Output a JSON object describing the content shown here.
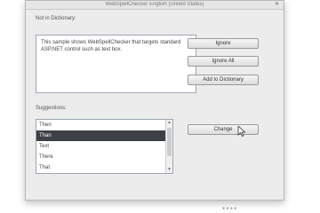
{
  "window": {
    "title": "WebSpellChecker English (United States)",
    "close_glyph": "✕"
  },
  "not_in_dictionary": {
    "label": "Not in Dictionary:",
    "text": "This sample shows WebSpellChecker that targets standard ASP.NET control such as text box."
  },
  "buttons": {
    "ignore": "Ignore",
    "ignore_all": "Ignore All",
    "add_to_dictionary": "Add to Dictionary",
    "change": "Change"
  },
  "suggestions": {
    "label": "Suggestions:",
    "items": [
      "Then",
      "Than",
      "Text",
      "There",
      "That"
    ],
    "selected_index": 1
  },
  "footer": {
    "status": "● ● ● ●"
  },
  "icons": {
    "close": "close-icon",
    "scroll_up": "chevron-up-icon",
    "scroll_down": "chevron-down-icon",
    "cursor": "mouse-pointer-icon"
  }
}
